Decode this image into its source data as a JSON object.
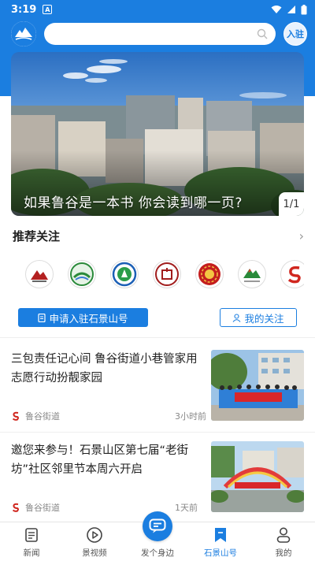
{
  "status_bar": {
    "time": "3:19",
    "notification_badge": "A"
  },
  "header": {
    "join_label": "入驻"
  },
  "banner": {
    "caption": "如果鲁谷是一本书 你会读到哪一页?",
    "counter": "1/1"
  },
  "recommend": {
    "title": "推荐关注",
    "accounts": [
      {
        "icon": "account-logo-1"
      },
      {
        "icon": "account-logo-2"
      },
      {
        "icon": "account-logo-3"
      },
      {
        "icon": "account-logo-4"
      },
      {
        "icon": "account-logo-5"
      },
      {
        "icon": "account-logo-6"
      },
      {
        "icon": "account-logo-7"
      }
    ]
  },
  "actions": {
    "apply_label": "申请入驻石景山号",
    "follow_label": "我的关注"
  },
  "news": [
    {
      "title": "三包责任记心间 鲁谷街道小巷管家用志愿行动扮靓家园",
      "source": "鲁谷街道",
      "time": "3小时前"
    },
    {
      "title": "邀您来参与！石景山区第七届“老街坊”社区邻里节本周六开启",
      "source": "鲁谷街道",
      "time": "1天前"
    }
  ],
  "tabs": [
    {
      "label": "新闻",
      "icon": "newspaper-icon"
    },
    {
      "label": "景视频",
      "icon": "play-icon"
    },
    {
      "label": "发个身边",
      "icon": "chat-icon"
    },
    {
      "label": "石景山号",
      "icon": "bookmark-icon",
      "active": true
    },
    {
      "label": "我的",
      "icon": "user-icon"
    }
  ],
  "colors": {
    "brand": "#1b7ee0"
  }
}
